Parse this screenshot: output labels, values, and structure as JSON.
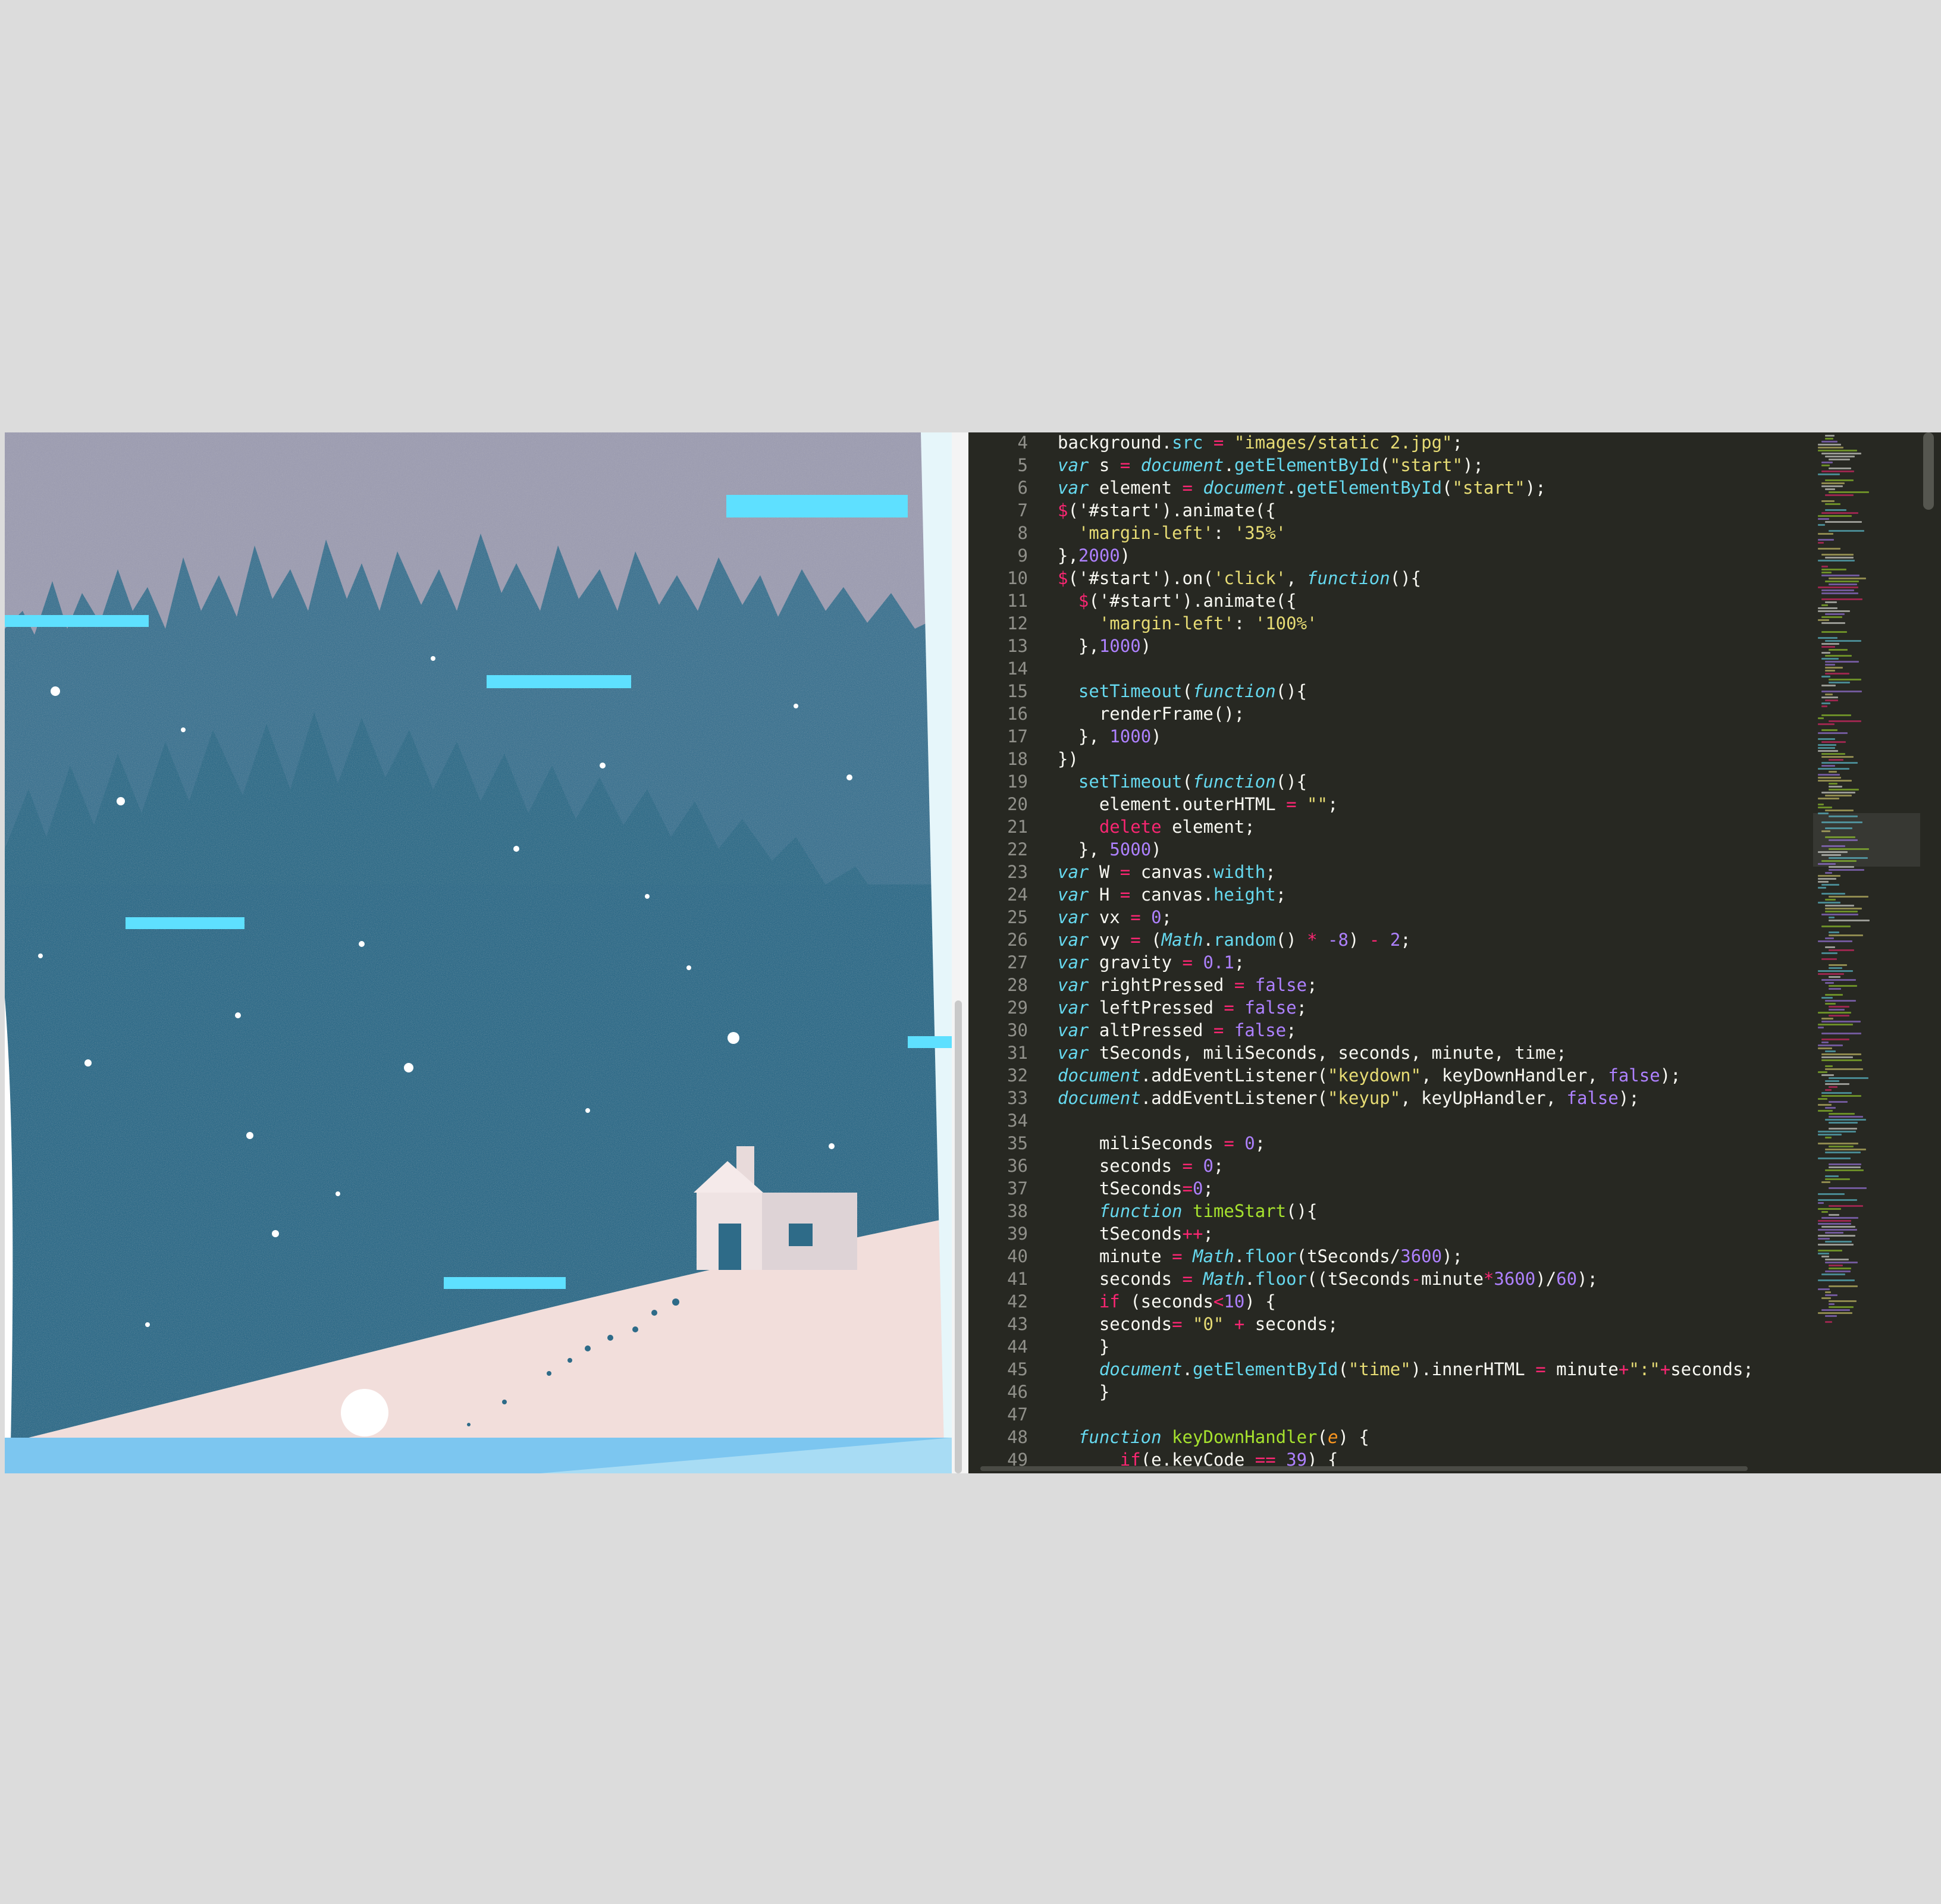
{
  "game": {
    "colors": {
      "sky": "#8d92aa",
      "forest": "#2e6b88",
      "snow": "#f2dedb",
      "platform": "#5ee0ff",
      "ground": "#7cc6f0",
      "ball": "#ffffff"
    }
  },
  "editor": {
    "theme": "monokai",
    "lines": [
      {
        "n": "4",
        "t": [
          [
            "background.",
            "p"
          ],
          [
            "src",
            "pr"
          ],
          [
            " ",
            "p"
          ],
          [
            "=",
            "rd"
          ],
          [
            " ",
            "p"
          ],
          [
            "\"images/static 2.jpg\"",
            "st"
          ],
          [
            ";",
            "p"
          ]
        ]
      },
      {
        "n": "5",
        "t": [
          [
            "var",
            "kw"
          ],
          [
            " s ",
            "p"
          ],
          [
            "=",
            "rd"
          ],
          [
            " ",
            "p"
          ],
          [
            "document",
            "ob"
          ],
          [
            ".",
            "p"
          ],
          [
            "getElementById",
            "pr"
          ],
          [
            "(",
            "p"
          ],
          [
            "\"start\"",
            "st"
          ],
          [
            ");",
            "p"
          ]
        ]
      },
      {
        "n": "6",
        "t": [
          [
            "var",
            "kw"
          ],
          [
            " element ",
            "p"
          ],
          [
            "=",
            "rd"
          ],
          [
            " ",
            "p"
          ],
          [
            "document",
            "ob"
          ],
          [
            ".",
            "p"
          ],
          [
            "getElementById",
            "pr"
          ],
          [
            "(",
            "p"
          ],
          [
            "\"start\"",
            "st"
          ],
          [
            ");",
            "p"
          ]
        ]
      },
      {
        "n": "7",
        "t": [
          [
            "$",
            "rd"
          ],
          [
            "('#start').animate({",
            "p"
          ]
        ]
      },
      {
        "n": "8",
        "t": [
          [
            "  ",
            "p"
          ],
          [
            "'margin-left'",
            "st"
          ],
          [
            ": ",
            "p"
          ],
          [
            "'35%'",
            "st"
          ]
        ]
      },
      {
        "n": "9",
        "t": [
          [
            "},",
            "p"
          ],
          [
            "2000",
            "nm"
          ],
          [
            ")",
            "p"
          ]
        ]
      },
      {
        "n": "10",
        "t": [
          [
            "$",
            "rd"
          ],
          [
            "('#start').on(",
            "p"
          ],
          [
            "'click'",
            "st"
          ],
          [
            ", ",
            "p"
          ],
          [
            "function",
            "kw"
          ],
          [
            "(){",
            "p"
          ]
        ]
      },
      {
        "n": "11",
        "t": [
          [
            "  ",
            "p"
          ],
          [
            "$",
            "rd"
          ],
          [
            "('#start').animate({",
            "p"
          ]
        ]
      },
      {
        "n": "12",
        "t": [
          [
            "    ",
            "p"
          ],
          [
            "'margin-left'",
            "st"
          ],
          [
            ": ",
            "p"
          ],
          [
            "'100%'",
            "st"
          ]
        ]
      },
      {
        "n": "13",
        "t": [
          [
            "  },",
            "p"
          ],
          [
            "1000",
            "nm"
          ],
          [
            ")",
            "p"
          ]
        ]
      },
      {
        "n": "14",
        "t": []
      },
      {
        "n": "15",
        "t": [
          [
            "  ",
            "p"
          ],
          [
            "setTimeout",
            "pr"
          ],
          [
            "(",
            "p"
          ],
          [
            "function",
            "kw"
          ],
          [
            "(){",
            "p"
          ]
        ]
      },
      {
        "n": "16",
        "t": [
          [
            "    renderFrame();",
            "p"
          ]
        ]
      },
      {
        "n": "17",
        "t": [
          [
            "  }, ",
            "p"
          ],
          [
            "1000",
            "nm"
          ],
          [
            ")",
            "p"
          ]
        ]
      },
      {
        "n": "18",
        "t": [
          [
            "})",
            "p"
          ]
        ]
      },
      {
        "n": "19",
        "t": [
          [
            "  ",
            "p"
          ],
          [
            "setTimeout",
            "pr"
          ],
          [
            "(",
            "p"
          ],
          [
            "function",
            "kw"
          ],
          [
            "(){",
            "p"
          ]
        ]
      },
      {
        "n": "20",
        "t": [
          [
            "    element.outerHTML ",
            "p"
          ],
          [
            "=",
            "rd"
          ],
          [
            " ",
            "p"
          ],
          [
            "\"\"",
            "st"
          ],
          [
            ";",
            "p"
          ]
        ]
      },
      {
        "n": "21",
        "t": [
          [
            "    ",
            "p"
          ],
          [
            "delete",
            "rd"
          ],
          [
            " element;",
            "p"
          ]
        ]
      },
      {
        "n": "22",
        "t": [
          [
            "  }, ",
            "p"
          ],
          [
            "5000",
            "nm"
          ],
          [
            ")",
            "p"
          ]
        ]
      },
      {
        "n": "23",
        "t": [
          [
            "var",
            "kw"
          ],
          [
            " W ",
            "p"
          ],
          [
            "=",
            "rd"
          ],
          [
            " canvas.",
            "p"
          ],
          [
            "width",
            "pr"
          ],
          [
            ";",
            "p"
          ]
        ]
      },
      {
        "n": "24",
        "t": [
          [
            "var",
            "kw"
          ],
          [
            " H ",
            "p"
          ],
          [
            "=",
            "rd"
          ],
          [
            " canvas.",
            "p"
          ],
          [
            "height",
            "pr"
          ],
          [
            ";",
            "p"
          ]
        ]
      },
      {
        "n": "25",
        "t": [
          [
            "var",
            "kw"
          ],
          [
            " vx ",
            "p"
          ],
          [
            "=",
            "rd"
          ],
          [
            " ",
            "p"
          ],
          [
            "0",
            "nm"
          ],
          [
            ";",
            "p"
          ]
        ]
      },
      {
        "n": "26",
        "t": [
          [
            "var",
            "kw"
          ],
          [
            " vy ",
            "p"
          ],
          [
            "=",
            "rd"
          ],
          [
            " (",
            "p"
          ],
          [
            "Math",
            "ob"
          ],
          [
            ".",
            "p"
          ],
          [
            "random",
            "pr"
          ],
          [
            "() ",
            "p"
          ],
          [
            "*",
            "rd"
          ],
          [
            " ",
            "p"
          ],
          [
            "-8",
            "nm"
          ],
          [
            ") ",
            "p"
          ],
          [
            "-",
            "rd"
          ],
          [
            " ",
            "p"
          ],
          [
            "2",
            "nm"
          ],
          [
            ";",
            "p"
          ]
        ]
      },
      {
        "n": "27",
        "t": [
          [
            "var",
            "kw"
          ],
          [
            " gravity ",
            "p"
          ],
          [
            "=",
            "rd"
          ],
          [
            " ",
            "p"
          ],
          [
            "0.1",
            "nm"
          ],
          [
            ";",
            "p"
          ]
        ]
      },
      {
        "n": "28",
        "t": [
          [
            "var",
            "kw"
          ],
          [
            " rightPressed ",
            "p"
          ],
          [
            "=",
            "rd"
          ],
          [
            " ",
            "p"
          ],
          [
            "false",
            "nm"
          ],
          [
            ";",
            "p"
          ]
        ]
      },
      {
        "n": "29",
        "t": [
          [
            "var",
            "kw"
          ],
          [
            " leftPressed ",
            "p"
          ],
          [
            "=",
            "rd"
          ],
          [
            " ",
            "p"
          ],
          [
            "false",
            "nm"
          ],
          [
            ";",
            "p"
          ]
        ]
      },
      {
        "n": "30",
        "t": [
          [
            "var",
            "kw"
          ],
          [
            " altPressed ",
            "p"
          ],
          [
            "=",
            "rd"
          ],
          [
            " ",
            "p"
          ],
          [
            "false",
            "nm"
          ],
          [
            ";",
            "p"
          ]
        ]
      },
      {
        "n": "31",
        "t": [
          [
            "var",
            "kw"
          ],
          [
            " tSeconds, miliSeconds, seconds, minute, time;",
            "p"
          ]
        ]
      },
      {
        "n": "32",
        "t": [
          [
            "document",
            "ob"
          ],
          [
            ".addEventListener(",
            "p"
          ],
          [
            "\"keydown\"",
            "st"
          ],
          [
            ", keyDownHandler, ",
            "p"
          ],
          [
            "false",
            "nm"
          ],
          [
            ");",
            "p"
          ]
        ]
      },
      {
        "n": "33",
        "t": [
          [
            "document",
            "ob"
          ],
          [
            ".addEventListener(",
            "p"
          ],
          [
            "\"keyup\"",
            "st"
          ],
          [
            ", keyUpHandler, ",
            "p"
          ],
          [
            "false",
            "nm"
          ],
          [
            ");",
            "p"
          ]
        ]
      },
      {
        "n": "34",
        "t": []
      },
      {
        "n": "35",
        "t": [
          [
            "    miliSeconds ",
            "p"
          ],
          [
            "=",
            "rd"
          ],
          [
            " ",
            "p"
          ],
          [
            "0",
            "nm"
          ],
          [
            ";",
            "p"
          ]
        ]
      },
      {
        "n": "36",
        "t": [
          [
            "    seconds ",
            "p"
          ],
          [
            "=",
            "rd"
          ],
          [
            " ",
            "p"
          ],
          [
            "0",
            "nm"
          ],
          [
            ";",
            "p"
          ]
        ]
      },
      {
        "n": "37",
        "t": [
          [
            "    tSeconds",
            "p"
          ],
          [
            "=",
            "rd"
          ],
          [
            "0",
            "nm"
          ],
          [
            ";",
            "p"
          ]
        ]
      },
      {
        "n": "38",
        "t": [
          [
            "    ",
            "p"
          ],
          [
            "function",
            "kw"
          ],
          [
            " ",
            "p"
          ],
          [
            "timeStart",
            "fn"
          ],
          [
            "(){",
            "p"
          ]
        ]
      },
      {
        "n": "39",
        "t": [
          [
            "    tSeconds",
            "p"
          ],
          [
            "++",
            "rd"
          ],
          [
            ";",
            "p"
          ]
        ]
      },
      {
        "n": "40",
        "t": [
          [
            "    minute ",
            "p"
          ],
          [
            "=",
            "rd"
          ],
          [
            " ",
            "p"
          ],
          [
            "Math",
            "ob"
          ],
          [
            ".",
            "p"
          ],
          [
            "floor",
            "pr"
          ],
          [
            "(tSeconds/",
            "p"
          ],
          [
            "3600",
            "nm"
          ],
          [
            ");",
            "p"
          ]
        ]
      },
      {
        "n": "41",
        "t": [
          [
            "    seconds ",
            "p"
          ],
          [
            "=",
            "rd"
          ],
          [
            " ",
            "p"
          ],
          [
            "Math",
            "ob"
          ],
          [
            ".",
            "p"
          ],
          [
            "floor",
            "pr"
          ],
          [
            "((tSeconds",
            "p"
          ],
          [
            "-",
            "rd"
          ],
          [
            "minute",
            "p"
          ],
          [
            "*",
            "rd"
          ],
          [
            "3600",
            "nm"
          ],
          [
            ")/",
            "p"
          ],
          [
            "60",
            "nm"
          ],
          [
            ");",
            "p"
          ]
        ]
      },
      {
        "n": "42",
        "t": [
          [
            "    ",
            "p"
          ],
          [
            "if",
            "rd"
          ],
          [
            " (seconds",
            "p"
          ],
          [
            "<",
            "rd"
          ],
          [
            "10",
            "nm"
          ],
          [
            ") {",
            "p"
          ]
        ]
      },
      {
        "n": "43",
        "t": [
          [
            "    seconds",
            "p"
          ],
          [
            "=",
            "rd"
          ],
          [
            " ",
            "p"
          ],
          [
            "\"0\"",
            "st"
          ],
          [
            " ",
            "p"
          ],
          [
            "+",
            "rd"
          ],
          [
            " seconds;",
            "p"
          ]
        ]
      },
      {
        "n": "44",
        "t": [
          [
            "    }",
            "p"
          ]
        ]
      },
      {
        "n": "45",
        "t": [
          [
            "    ",
            "p"
          ],
          [
            "document",
            "ob"
          ],
          [
            ".",
            "p"
          ],
          [
            "getElementById",
            "pr"
          ],
          [
            "(",
            "p"
          ],
          [
            "\"time\"",
            "st"
          ],
          [
            ").innerHTML ",
            "p"
          ],
          [
            "=",
            "rd"
          ],
          [
            " minute",
            "p"
          ],
          [
            "+",
            "rd"
          ],
          [
            "\":\"",
            "st"
          ],
          [
            "+",
            "rd"
          ],
          [
            "seconds;",
            "p"
          ]
        ]
      },
      {
        "n": "46",
        "t": [
          [
            "    }",
            "p"
          ]
        ]
      },
      {
        "n": "47",
        "t": []
      },
      {
        "n": "48",
        "t": [
          [
            "  ",
            "p"
          ],
          [
            "function",
            "kw"
          ],
          [
            " ",
            "p"
          ],
          [
            "keyDownHandler",
            "fn"
          ],
          [
            "(",
            "p"
          ],
          [
            "e",
            "pa"
          ],
          [
            ") {",
            "p"
          ]
        ]
      },
      {
        "n": "49",
        "t": [
          [
            "      ",
            "p"
          ],
          [
            "if",
            "rd"
          ],
          [
            "(e.keyCode ",
            "p"
          ],
          [
            "==",
            "rd"
          ],
          [
            " ",
            "p"
          ],
          [
            "39",
            "nm"
          ],
          [
            ") {",
            "p"
          ]
        ]
      }
    ]
  }
}
